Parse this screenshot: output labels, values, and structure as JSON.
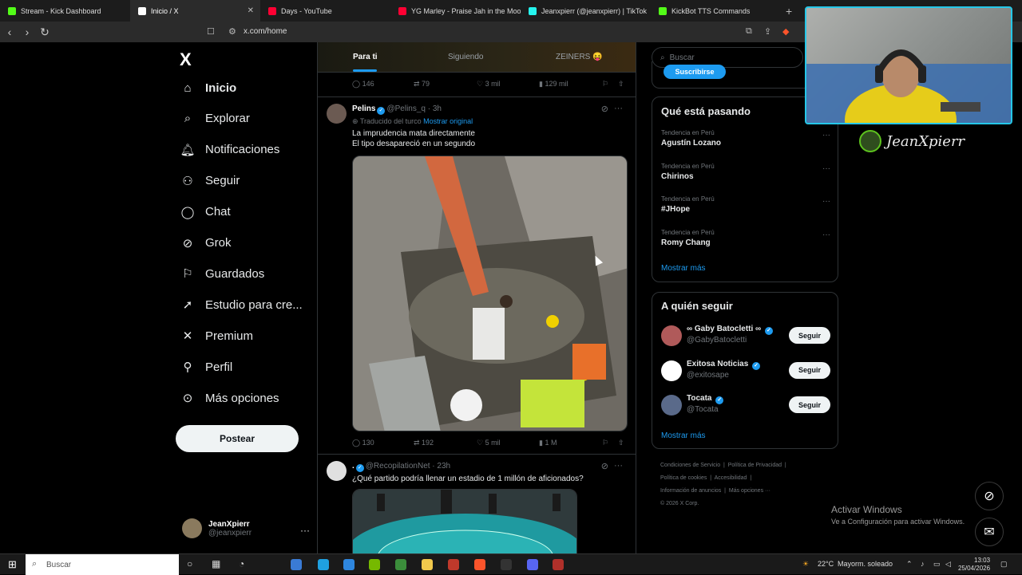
{
  "browser": {
    "tabs": [
      {
        "title": "Stream - Kick Dashboard",
        "color": "#53fc18"
      },
      {
        "title": "Inicio / X",
        "color": "#ffffff",
        "active": true
      },
      {
        "title": "Days - YouTube",
        "color": "#ff0033"
      },
      {
        "title": "YG Marley - Praise Jah in the Moonlig",
        "color": "#ff0033"
      },
      {
        "title": "Jeanxpierr (@jeanxpierr) | TikTok",
        "color": "#25f4ee"
      },
      {
        "title": "KickBot TTS Commands",
        "color": "#53fc18"
      }
    ],
    "new_tab": "+",
    "url": "x.com/home"
  },
  "nav": {
    "logo": "X",
    "items": [
      {
        "label": "Inicio",
        "icon": "home-icon"
      },
      {
        "label": "Explorar",
        "icon": "search-icon"
      },
      {
        "label": "Notificaciones",
        "icon": "bell-icon"
      },
      {
        "label": "Seguir",
        "icon": "person-plus-icon"
      },
      {
        "label": "Chat",
        "icon": "chat-icon"
      },
      {
        "label": "Grok",
        "icon": "grok-icon"
      },
      {
        "label": "Guardados",
        "icon": "bookmark-icon"
      },
      {
        "label": "Estudio para cre...",
        "icon": "rocket-icon"
      },
      {
        "label": "Premium",
        "icon": "x-icon"
      },
      {
        "label": "Perfil",
        "icon": "person-icon"
      },
      {
        "label": "Más opciones",
        "icon": "more-circle-icon"
      }
    ],
    "post_button": "Postear",
    "user": {
      "name": "JeanXpierr",
      "handle": "@jeanxpierr"
    }
  },
  "timeline": {
    "tabs": [
      "Para ti",
      "Siguiendo",
      "ZEINERS 😝"
    ],
    "prev_actions": {
      "replies": "146",
      "reposts": "79",
      "likes": "3 mil",
      "views": "129 mil"
    },
    "tweets": [
      {
        "name": "Pelins",
        "handle": "@Pelins_q",
        "time": "3h",
        "translated": "Traducido del turco",
        "show_original": "Mostrar original",
        "text_line1": "La imprudencia mata directamente",
        "text_line2": "El tipo desapareció en un segundo",
        "actions": {
          "replies": "130",
          "reposts": "192",
          "likes": "5 mil",
          "views": "1 M"
        }
      },
      {
        "name": ".",
        "handle": "@RecopilationNet",
        "time": "23h",
        "text_line1": "¿Qué partido podría llenar un estadio de 1 millón de aficionados?"
      }
    ]
  },
  "sidebar": {
    "search_placeholder": "Buscar",
    "subscribe_label": "Suscribirse",
    "trends_title": "Qué está pasando",
    "trends": [
      {
        "category": "Tendencia en Perú",
        "name": "Agustín Lozano"
      },
      {
        "category": "Tendencia en Perú",
        "name": "Chirinos"
      },
      {
        "category": "Tendencia en Perú",
        "name": "#JHope"
      },
      {
        "category": "Tendencia en Perú",
        "name": "Romy Chang"
      }
    ],
    "show_more": "Mostrar más",
    "follow_title": "A quién seguir",
    "follow": [
      {
        "name": "∞ Gaby Batocletti ∞",
        "handle": "@GabyBatocletti",
        "button": "Seguir",
        "color": "#b05a5a"
      },
      {
        "name": "Exitosa Noticias",
        "handle": "@exitosape",
        "button": "Seguir",
        "color": "#ffffff"
      },
      {
        "name": "Tocata",
        "handle": "@Tocata",
        "button": "Seguir",
        "color": "#5a6a8a"
      }
    ],
    "follow_more": "Mostrar más",
    "footer": {
      "line1a": "Condiciones de Servicio",
      "line1b": "Política de Privacidad",
      "line2a": "Política de cookies",
      "line2b": "Accesibilidad",
      "line3a": "Información de anuncios",
      "line3b": "Más opciones ···",
      "line4": "© 2026 X Corp."
    }
  },
  "overlay": {
    "streamer_name": "JeanXpierr",
    "activate_title": "Activar Windows",
    "activate_sub": "Ve a Configuración para activar Windows."
  },
  "taskbar": {
    "search": "Buscar",
    "weather_temp": "22°C",
    "weather_text": "Mayorm. soleado",
    "time": "13:03",
    "date": "25/04/2026"
  }
}
